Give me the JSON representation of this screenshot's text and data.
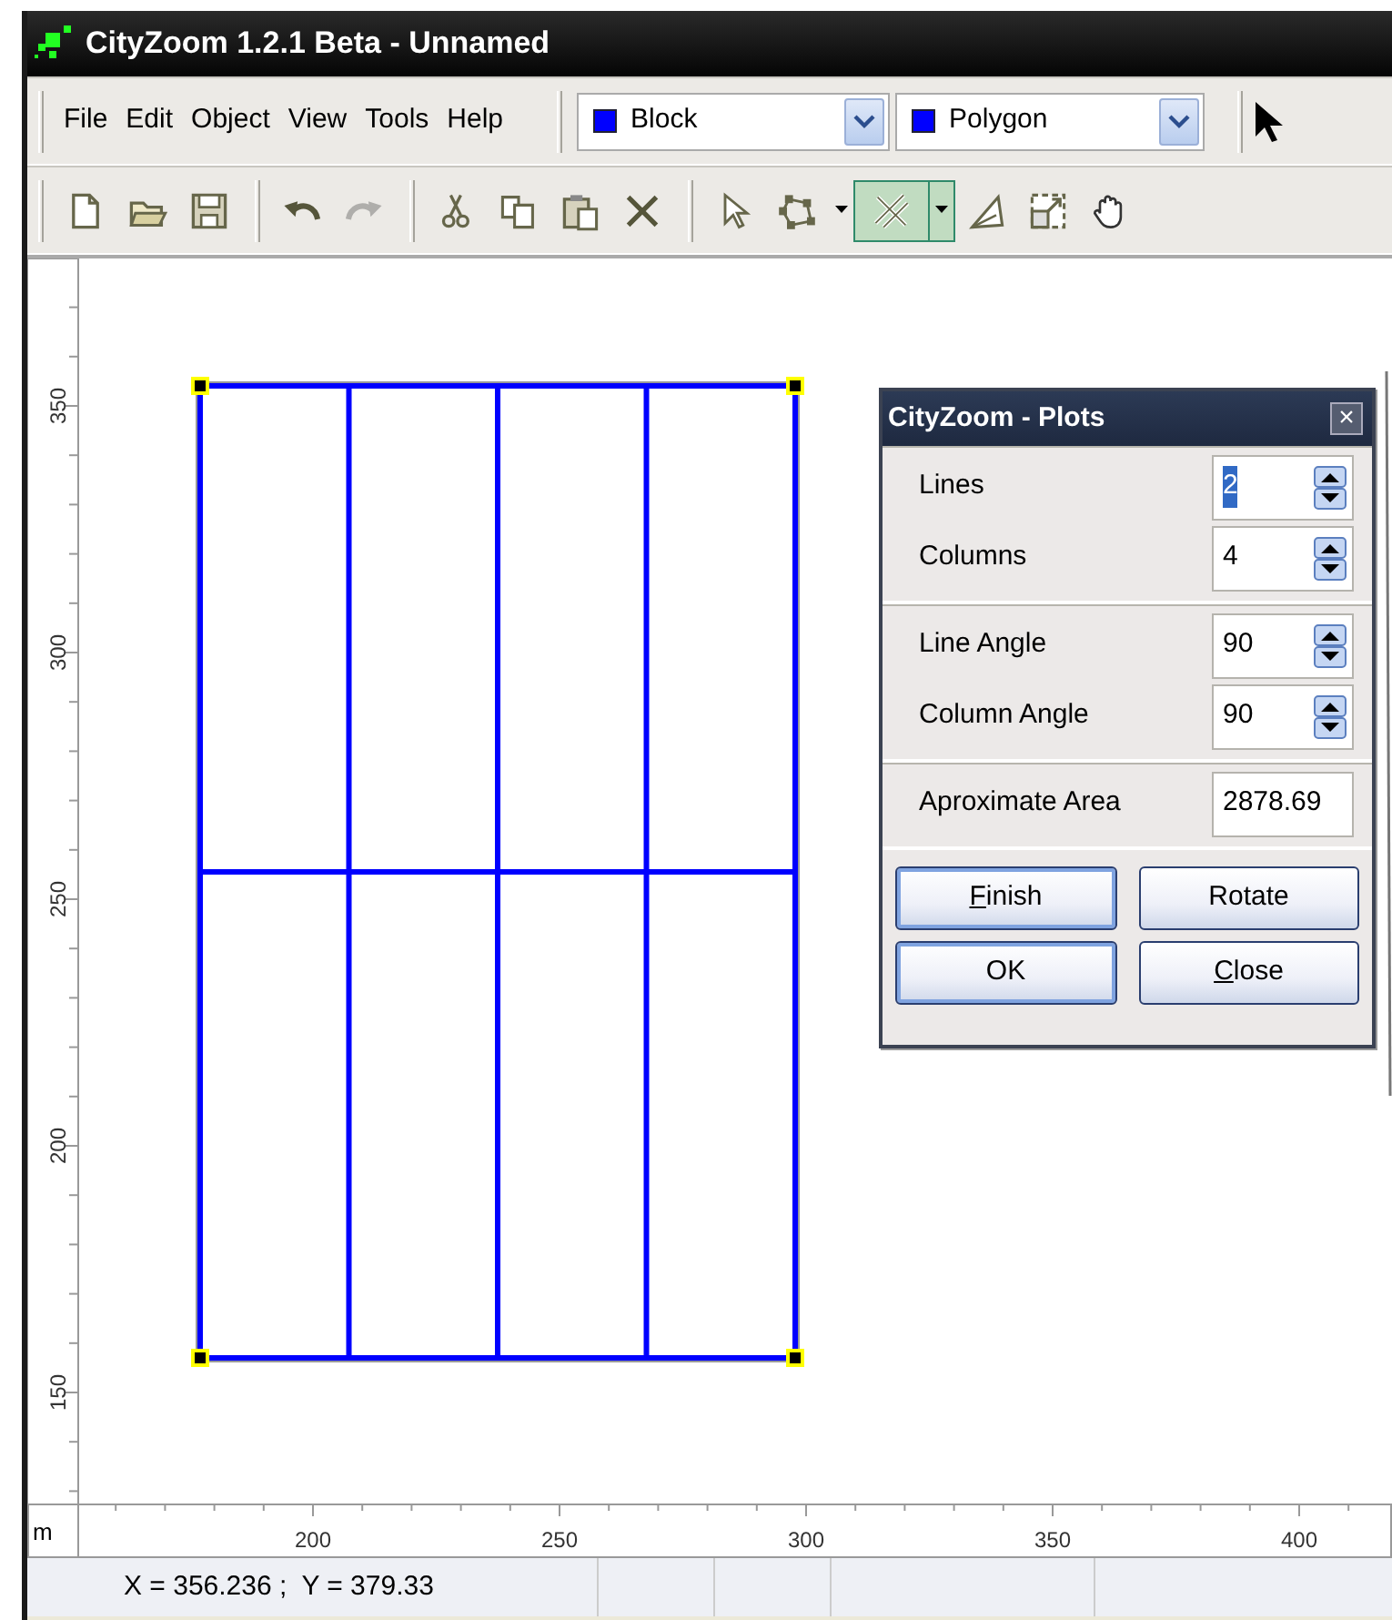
{
  "window": {
    "title": "CityZoom 1.2.1 Beta - Unnamed"
  },
  "menu": [
    "File",
    "Edit",
    "Object",
    "View",
    "Tools",
    "Help"
  ],
  "combos": [
    {
      "label": "Block",
      "color": "#0000ff"
    },
    {
      "label": "Polygon",
      "color": "#0000ff"
    }
  ],
  "toolbar": [
    [
      {
        "kind": "tool",
        "disabled": false,
        "pressed": false
      },
      {
        "kind": "tool",
        "disabled": false,
        "pressed": false
      },
      {
        "kind": "tool",
        "disabled": false,
        "pressed": false
      }
    ],
    [
      {
        "kind": "tool",
        "disabled": false,
        "pressed": false
      },
      {
        "kind": "tool",
        "disabled": true,
        "pressed": false
      }
    ],
    [
      {
        "kind": "tool",
        "disabled": false,
        "pressed": false
      },
      {
        "kind": "tool",
        "disabled": false,
        "pressed": false
      },
      {
        "kind": "tool",
        "disabled": false,
        "pressed": false
      },
      {
        "kind": "tool",
        "disabled": false,
        "pressed": false
      }
    ],
    [
      {
        "kind": "tool",
        "disabled": false,
        "pressed": false
      },
      {
        "kind": "tool",
        "disabled": false,
        "pressed": false
      },
      {
        "kind": "caret",
        "disabled": false,
        "pressed": false
      },
      {
        "kind": "split",
        "disabled": false,
        "pressed": true
      },
      {
        "kind": "tool",
        "disabled": false,
        "pressed": false
      },
      {
        "kind": "tool",
        "disabled": false,
        "pressed": false
      },
      {
        "kind": "tool",
        "disabled": false,
        "pressed": false
      }
    ]
  ],
  "rulers": {
    "unit": "m",
    "x_labels": [
      "200",
      "250",
      "300",
      "350",
      "400"
    ],
    "y_labels": [
      "350",
      "300",
      "250",
      "200",
      "150"
    ]
  },
  "dialog": {
    "title": "CityZoom - Plots",
    "close": "×",
    "sections": [
      {
        "fields": [
          {
            "label": "Lines",
            "value": "2",
            "kind": "spin",
            "text_selected": true
          },
          {
            "label": "Columns",
            "value": "4",
            "kind": "spin",
            "text_selected": false
          }
        ]
      },
      {
        "fields": [
          {
            "label": "Line Angle",
            "value": "90",
            "kind": "spin",
            "text_selected": false
          },
          {
            "label": "Column Angle",
            "value": "90",
            "kind": "spin",
            "text_selected": false
          }
        ]
      },
      {
        "fields": [
          {
            "label": "Aproximate Area",
            "value": "2878.69",
            "kind": "text",
            "text_selected": false
          }
        ]
      }
    ],
    "buttons": [
      {
        "label": "Finish",
        "underline_first": true,
        "default": true
      },
      {
        "label": "Rotate",
        "underline_first": false,
        "default": false
      },
      {
        "label": "OK",
        "underline_first": false,
        "default": true
      },
      {
        "label": "Close",
        "underline_first": true,
        "default": false
      }
    ]
  },
  "status_bar": {
    "coordinates": "X = 356.236 ;  Y = 379.33"
  }
}
